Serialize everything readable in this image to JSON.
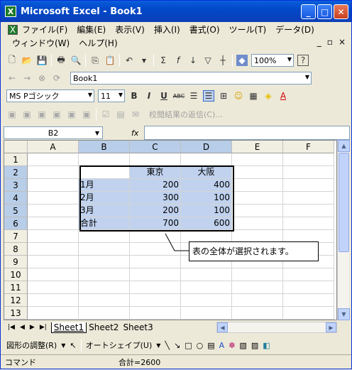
{
  "window": {
    "title": "Microsoft Excel - Book1",
    "icon_letter": "X"
  },
  "menu": {
    "row1": [
      "ファイル(F)",
      "編集(E)",
      "表示(V)",
      "挿入(I)",
      "書式(O)",
      "ツール(T)",
      "データ(D)"
    ],
    "row2": [
      "ウィンドウ(W)",
      "ヘルプ(H)"
    ]
  },
  "toolbar": {
    "zoom": "100%",
    "help_icon": "?"
  },
  "web_toolbar": {
    "address": "Book1"
  },
  "format": {
    "font": "MS Pゴシック",
    "size": "11",
    "bold": "B",
    "italic": "I",
    "underline": "U",
    "abc": "ABC"
  },
  "review_toolbar": {
    "reply_label": "校閲結果の返信(C)..."
  },
  "formula_bar": {
    "namebox": "B2",
    "fx": "fx",
    "content": ""
  },
  "grid": {
    "columns": [
      "A",
      "B",
      "C",
      "D",
      "E",
      "F"
    ],
    "rows": [
      "1",
      "2",
      "3",
      "4",
      "5",
      "6",
      "7",
      "8",
      "9",
      "10",
      "11",
      "12",
      "13"
    ],
    "table": {
      "header": [
        "",
        "東京",
        "大阪"
      ],
      "body": [
        [
          "1月",
          "200",
          "400"
        ],
        [
          "2月",
          "300",
          "100"
        ],
        [
          "3月",
          "200",
          "100"
        ],
        [
          "合計",
          "700",
          "600"
        ]
      ]
    }
  },
  "callout": {
    "text": "表の全体が選択されます。"
  },
  "sheets": [
    "Sheet1",
    "Sheet2",
    "Sheet3"
  ],
  "drawing": {
    "adjust_label": "図形の調整(R)",
    "autoshape_label": "オートシェイプ(U)"
  },
  "status": {
    "mode": "コマンド",
    "sum": "合計=2600"
  }
}
